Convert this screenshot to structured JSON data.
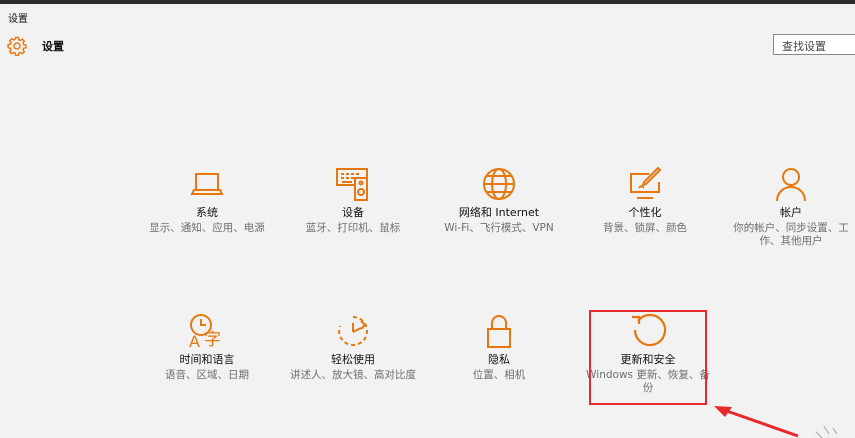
{
  "window": {
    "title": "设置"
  },
  "header": {
    "title": "设置",
    "icon": "gear-icon"
  },
  "search": {
    "placeholder": "查找设置"
  },
  "colors": {
    "accent": "#e8770e",
    "highlight": "#e8282b"
  },
  "tiles": [
    {
      "icon": "laptop-icon",
      "name": "系统",
      "desc": "显示、通知、应用、电源"
    },
    {
      "icon": "keyboard-speaker-icon",
      "name": "设备",
      "desc": "蓝牙、打印机、鼠标"
    },
    {
      "icon": "globe-icon",
      "name": "网络和 Internet",
      "desc": "Wi-Fi、飞行模式、VPN"
    },
    {
      "icon": "paint-monitor-icon",
      "name": "个性化",
      "desc": "背景、锁屏、颜色"
    },
    {
      "icon": "person-icon",
      "name": "帐户",
      "desc": "你的帐户、同步设置、工作、其他用户"
    },
    {
      "icon": "time-language-icon",
      "name": "时间和语言",
      "desc": "语音、区域、日期"
    },
    {
      "icon": "ease-of-access-icon",
      "name": "轻松使用",
      "desc": "讲述人、放大镜、高对比度"
    },
    {
      "icon": "lock-icon",
      "name": "隐私",
      "desc": "位置、相机"
    },
    {
      "icon": "update-refresh-icon",
      "name": "更新和安全",
      "desc": "Windows 更新、恢复、备份"
    }
  ]
}
